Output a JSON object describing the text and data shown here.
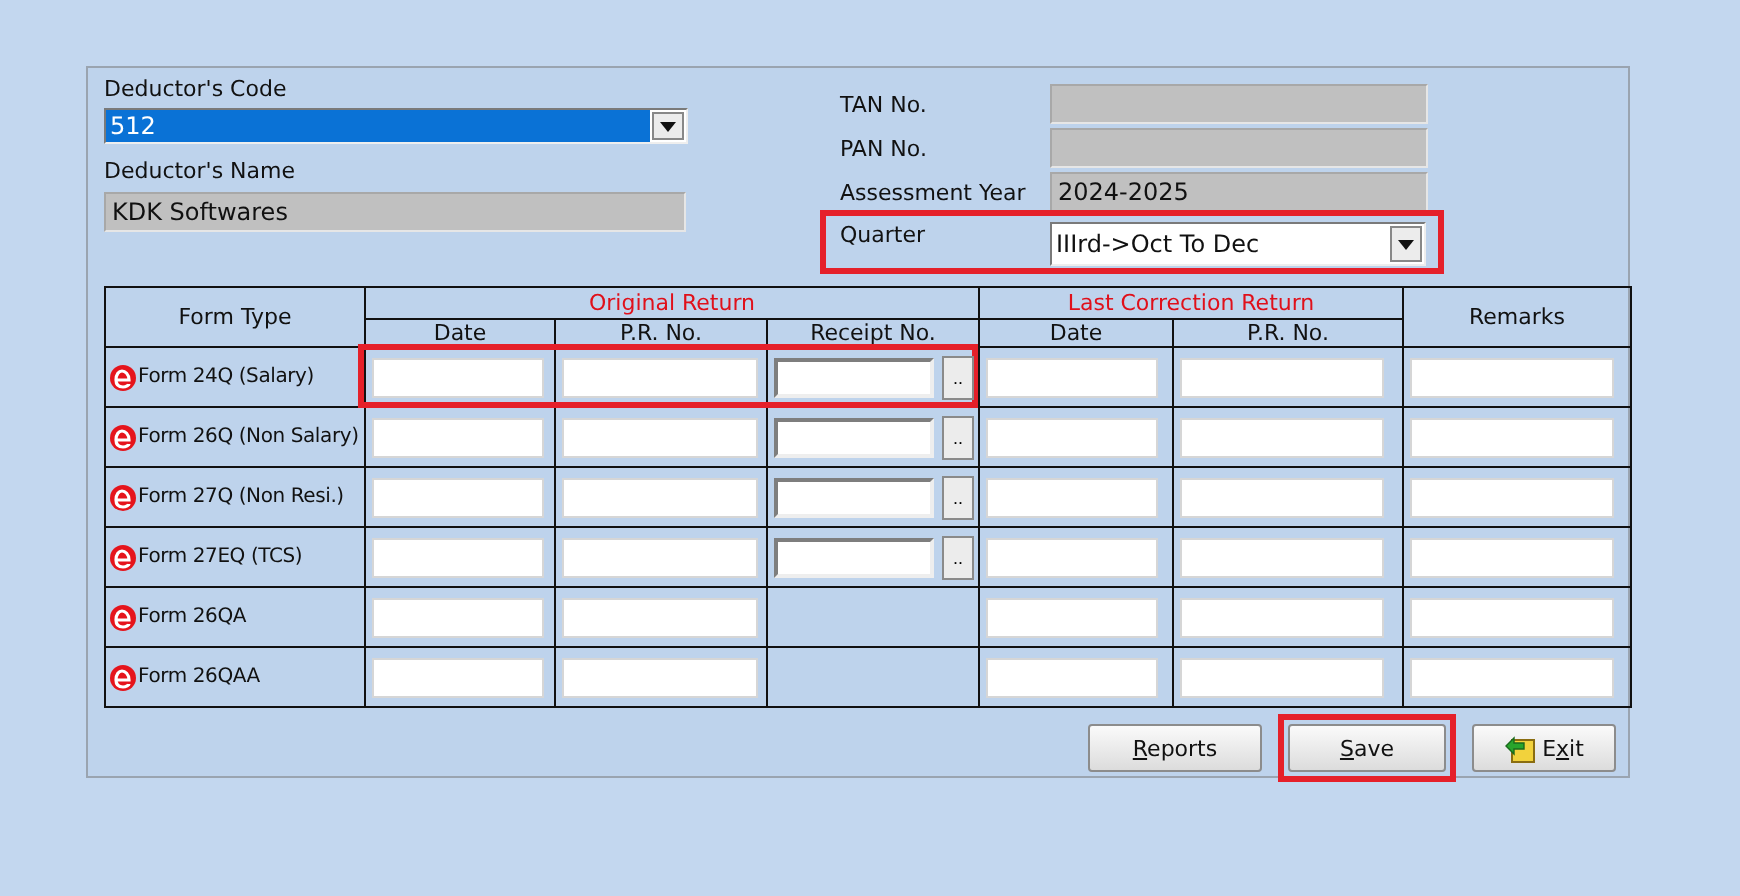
{
  "deductor": {
    "code_label": "Deductor's Code",
    "code": "512",
    "name_label": "Deductor's Name",
    "name": "KDK Softwares"
  },
  "info": [
    {
      "label": "TAN No.",
      "kind": "text",
      "highlighted": false
    },
    {
      "label": "PAN No.",
      "kind": "text",
      "highlighted": false
    },
    {
      "label": "Assessment Year",
      "value": "2024-2025",
      "kind": "text",
      "highlighted": false
    },
    {
      "label": "Quarter",
      "value": "IIIrd->Oct To Dec",
      "kind": "combo",
      "highlighted": true
    }
  ],
  "table": {
    "form_type": "Form Type",
    "original": "Original Return",
    "correction": "Last Correction Return",
    "remarks": "Remarks",
    "columns": [
      "Date",
      "P.R. No.",
      "Receipt No.",
      "Date",
      "P.R. No."
    ],
    "rows": [
      {
        "form": "Form 24Q (Salary)",
        "receipt_button": "..",
        "highlighted": true
      },
      {
        "form": "Form 26Q (Non Salary)",
        "receipt_button": "..",
        "highlighted": false
      },
      {
        "form": "Form 27Q (Non Resi.)",
        "receipt_button": "..",
        "highlighted": false
      },
      {
        "form": "Form 27EQ (TCS)",
        "receipt_button": "..",
        "highlighted": false
      },
      {
        "form": "Form 26QA",
        "highlighted": false
      },
      {
        "form": "Form 26QAA",
        "highlighted": false
      }
    ]
  },
  "buttons": [
    {
      "mnemonic": "R",
      "after": "eports",
      "kind": "plain",
      "highlighted": false
    },
    {
      "mnemonic": "S",
      "after": "ave",
      "kind": "plain",
      "highlighted": true
    },
    {
      "before": "E",
      "mnemonic": "x",
      "after": "it",
      "kind": "exit",
      "highlighted": false
    }
  ]
}
